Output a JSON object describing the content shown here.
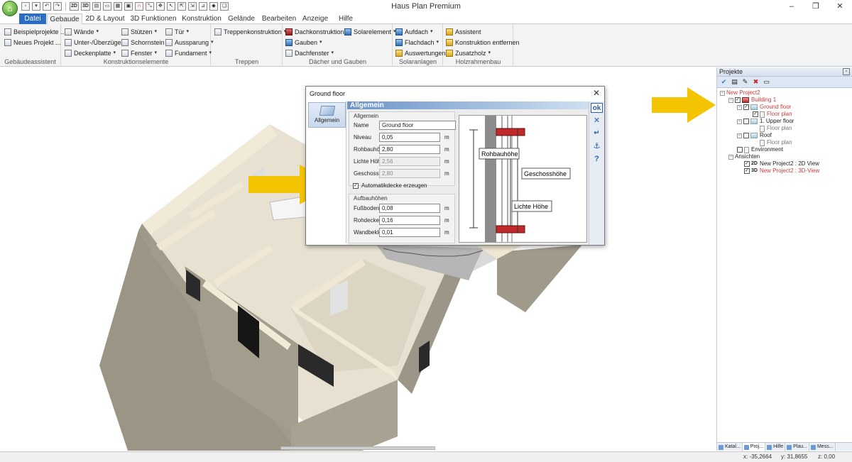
{
  "window": {
    "title": "Haus Plan Premium",
    "controls": [
      "–",
      "❐",
      "✕"
    ]
  },
  "quick_access": [
    "2D",
    "3D"
  ],
  "tabs": [
    "Datei",
    "Gebaude",
    "2D & Layout",
    "3D Funktionen",
    "Konstruktion",
    "Gelände",
    "Bearbeiten",
    "Anzeige",
    "Hilfe"
  ],
  "ribbon": {
    "groups": [
      {
        "label": "Gebäudeassistent",
        "items": [
          "Beispielprojekte ...",
          "Neues Projekt ..."
        ]
      },
      {
        "label": "Konstruktionselemente",
        "items": [
          "Wände",
          "Unter-/Überzüge",
          "Deckenplatte",
          "Stützen",
          "Schornstein",
          "Fenster",
          "Tür",
          "Aussparung",
          "Fundament"
        ]
      },
      {
        "label": "Treppen",
        "items": [
          "Treppenkonstruktion"
        ]
      },
      {
        "label": "Dächer und Gauben",
        "items": [
          "Dachkonstruktion",
          "Gauben",
          "Dachfenster",
          "Solarelement"
        ]
      },
      {
        "label": "Solaranlagen",
        "items": [
          "Aufdach",
          "Flachdach",
          "Auswertungen"
        ]
      },
      {
        "label": "Holzrahmenbau",
        "items": [
          "Assistent",
          "Konstruktion entfernen",
          "Zusatzholz"
        ]
      }
    ]
  },
  "panel": {
    "title": "Projekte",
    "tree": {
      "project": "New Project2",
      "building": "Building 1",
      "ground_floor": "Ground floor",
      "floor_plan": "Floor plan",
      "upper_floor": "1. Upper floor",
      "roof": "Roof",
      "environment": "Environment",
      "views": "Ansichten",
      "view_2d_badge": "2D",
      "view_2d": "New Project2 : 2D View",
      "view_3d_badge": "3D",
      "view_3d": "New Project2 : 3D-View"
    },
    "bottom_tabs": [
      "Katal...",
      "Proj...",
      "Hilfe",
      "Plau...",
      "Mess..."
    ]
  },
  "status": {
    "x": "x: -35,2664",
    "y": "y: 31,8655",
    "z": "z: 0,00"
  },
  "dialog": {
    "title": "Ground floor",
    "nav_label": "Allgemein",
    "header": "Allgemein",
    "group_general": "Allgemein",
    "group_build": "Aufbauhöhen",
    "fields": {
      "name_label": "Name",
      "name_value": "Ground floor",
      "niveau_label": "Niveau",
      "niveau_value": "0,05",
      "rohbau_label": "Rohbauhöhe",
      "rohbau_value": "2,80",
      "lichte_label": "Lichte Höhe",
      "lichte_value": "2,56",
      "geschoss_label": "Geschosshöhe",
      "geschoss_value": "2,80",
      "fuss_label": "Fußboden",
      "fuss_value": "0,08",
      "rohdecke_label": "Rohdecke",
      "rohdecke_value": "0,16",
      "wand_label": "Wandbekleidung",
      "wand_value": "0,01",
      "unit": "m"
    },
    "checkbox_label": "Automatikdecke erzeugen",
    "diagram_labels": {
      "rohbau": "Rohbauhöhe",
      "geschoss": "Geschosshöhe",
      "lichte": "Lichte Höhe"
    },
    "side_buttons": {
      "ok": "ok",
      "cancel": "✕",
      "help": "?"
    }
  },
  "colors": {
    "accent": "#2b6cc4",
    "arrow": "#f5c400",
    "wall": "#a39d8e",
    "floor": "#e6dfcf",
    "tree_red": "#d03a3a"
  }
}
